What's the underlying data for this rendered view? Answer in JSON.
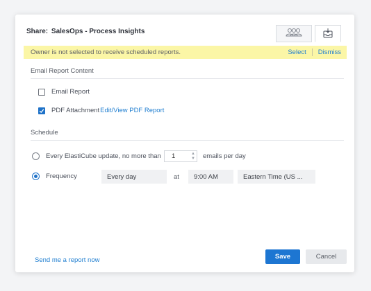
{
  "dialog": {
    "title_prefix": "Share:",
    "dashboard_name": "SalesOps - Process Insights",
    "tabs": [
      {
        "icon": "users-icon"
      },
      {
        "icon": "inbox-icon"
      }
    ]
  },
  "banner": {
    "message": "Owner is not selected to receive scheduled reports.",
    "select_label": "Select",
    "dismiss_label": "Dismiss",
    "background": "#fbf6a6"
  },
  "email_content": {
    "heading": "Email Report Content",
    "email_report": {
      "label": "Email Report",
      "checked": false
    },
    "pdf_attachment": {
      "label": "PDF Attachment",
      "checked": true,
      "link": "Edit/View PDF Report"
    }
  },
  "schedule": {
    "heading": "Schedule",
    "elasticube": {
      "label": "Every ElastiCube update, no more than",
      "value": "1",
      "suffix": "emails per day",
      "selected": false
    },
    "frequency": {
      "label": "Frequency",
      "value": "Every day",
      "at_label": "at",
      "time": "9:00 AM",
      "timezone": "Eastern Time (US ...",
      "selected": true
    }
  },
  "footer": {
    "send_now": "Send me a report now",
    "save": "Save",
    "cancel": "Cancel",
    "accent": "#1d76d2"
  }
}
